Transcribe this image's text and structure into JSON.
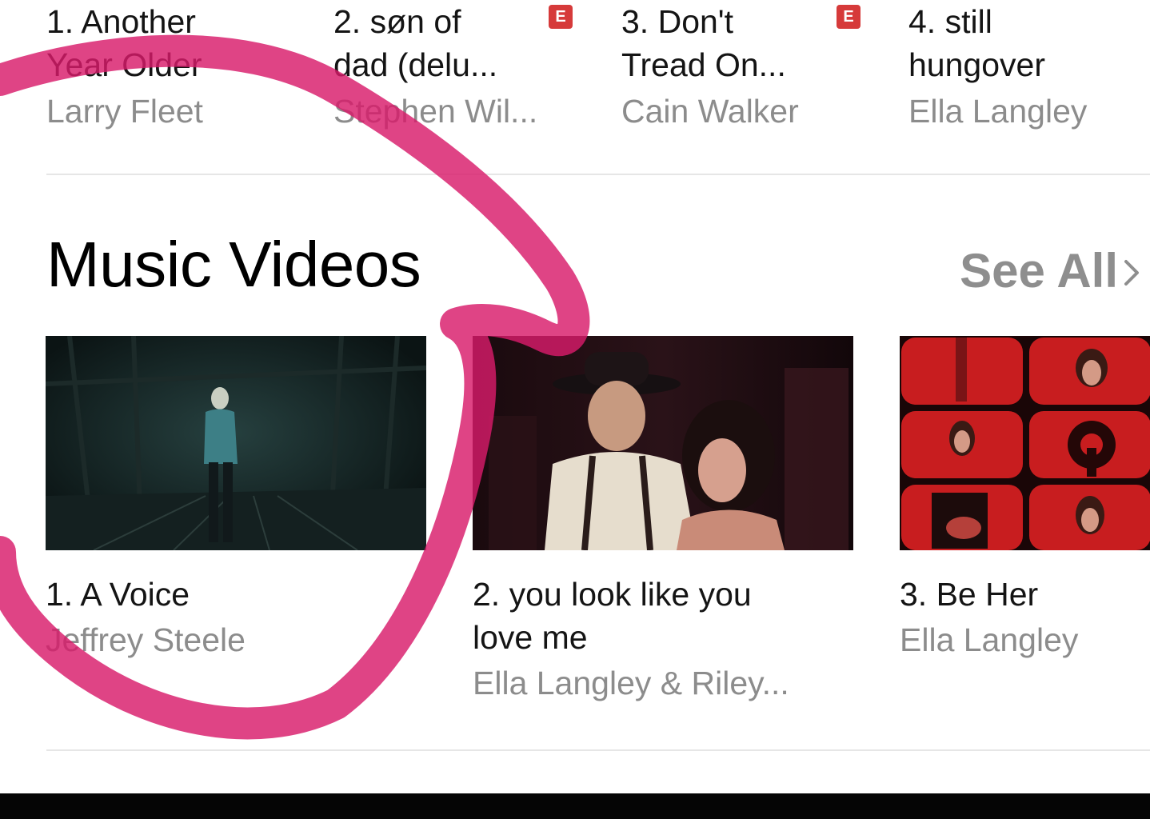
{
  "songs": [
    {
      "title": "1. Another\nYear Older",
      "artist": "Larry Fleet",
      "explicit": false
    },
    {
      "title": "2. søn of\ndad (delu...",
      "artist": "Stephen Wil...",
      "explicit": true
    },
    {
      "title": "3. Don't\nTread On...",
      "artist": "Cain Walker",
      "explicit": true
    },
    {
      "title": "4. still\nhungover",
      "artist": "Ella Langley",
      "explicit": false
    }
  ],
  "explicit_label": "E",
  "section": {
    "title": "Music Videos",
    "see_all_label": "See All",
    "see_all_icon": "chevron-right-icon"
  },
  "videos": [
    {
      "title": "1. A Voice",
      "artist": "Jeffrey Steele"
    },
    {
      "title": "2. you look like you\nlove me",
      "artist": "Ella Langley & Riley..."
    },
    {
      "title": "3. Be Her",
      "artist": "Ella Langley"
    }
  ],
  "colors": {
    "background": "#ffffff",
    "title_text": "#141414",
    "secondary_text": "#8c8c8c",
    "explicit_badge": "#d63a3a",
    "annotation_stroke": "#d81b6a",
    "bottom_bar": "#050505"
  }
}
